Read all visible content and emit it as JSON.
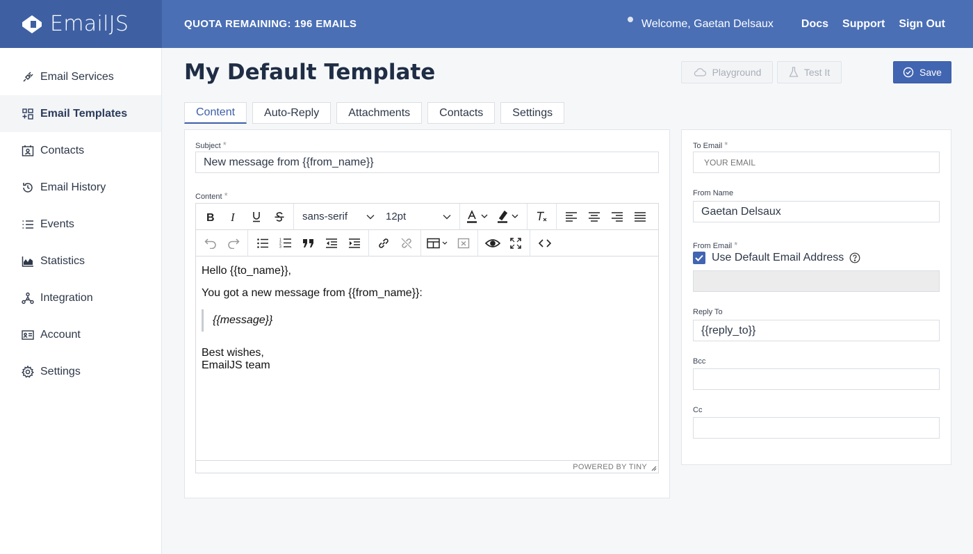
{
  "header": {
    "logo_text": "EmailJS",
    "quota": "QUOTA REMAINING: 196 EMAILS",
    "welcome": "Welcome,  Gaetan Delsaux",
    "links": [
      "Docs",
      "Support",
      "Sign Out"
    ]
  },
  "sidebar": {
    "items": [
      {
        "label": "Email Services",
        "icon": "plug-icon"
      },
      {
        "label": "Email Templates",
        "icon": "templates-icon",
        "active": true
      },
      {
        "label": "Contacts",
        "icon": "contacts-icon"
      },
      {
        "label": "Email History",
        "icon": "history-icon"
      },
      {
        "label": "Events",
        "icon": "events-list-icon"
      },
      {
        "label": "Statistics",
        "icon": "chart-icon"
      },
      {
        "label": "Integration",
        "icon": "integration-icon"
      },
      {
        "label": "Account",
        "icon": "account-card-icon"
      },
      {
        "label": "Settings",
        "icon": "gear-icon"
      }
    ]
  },
  "page": {
    "title": "My Default Template",
    "playground_label": "Playground",
    "test_label": "Test It",
    "save_label": "Save"
  },
  "tabs": [
    "Content",
    "Auto-Reply",
    "Attachments",
    "Contacts",
    "Settings"
  ],
  "content_panel": {
    "subject_label": "Subject",
    "subject_value": "New message from {{from_name}}",
    "content_label": "Content",
    "font_family": "sans-serif",
    "font_size": "12pt",
    "body": {
      "line1": "Hello {{to_name}},",
      "line2": "You got a new message from {{from_name}}:",
      "quote": "{{message}}",
      "closing1": "Best wishes,",
      "closing2": "EmailJS team"
    },
    "status_text": "POWERED BY TINY"
  },
  "side_panel": {
    "to_email_label": "To Email",
    "to_email_placeholder": "YOUR EMAIL",
    "from_name_label": "From Name",
    "from_name_value": "Gaetan Delsaux",
    "from_email_label": "From Email",
    "use_default_label": "Use Default Email Address",
    "use_default_checked": true,
    "reply_to_label": "Reply To",
    "reply_to_value": "{{reply_to}}",
    "bcc_label": "Bcc",
    "cc_label": "Cc"
  },
  "colors": {
    "header": "#4a6fb5",
    "logo_bg": "#3e60a3",
    "accent": "#4265b2"
  }
}
